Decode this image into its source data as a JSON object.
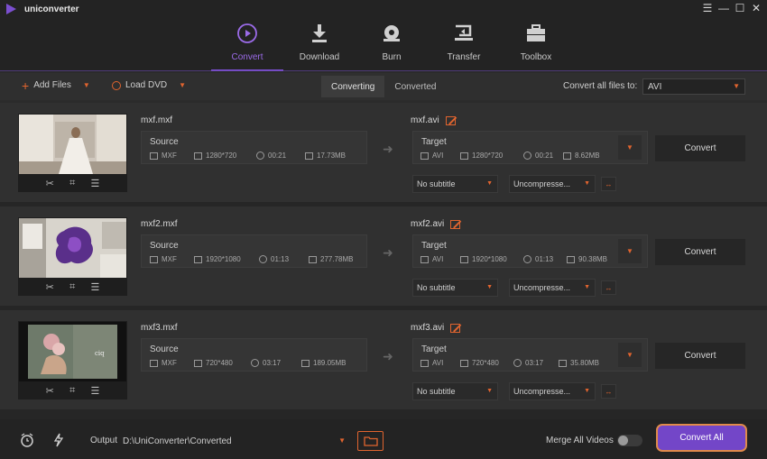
{
  "app": {
    "title": "uniconverter"
  },
  "window_controls": [
    "menu-icon",
    "minimize-icon",
    "maximize-icon",
    "close-icon"
  ],
  "nav": [
    {
      "label": "Convert",
      "icon": "convert-icon",
      "active": true
    },
    {
      "label": "Download",
      "icon": "download-icon",
      "active": false
    },
    {
      "label": "Burn",
      "icon": "burn-icon",
      "active": false
    },
    {
      "label": "Transfer",
      "icon": "transfer-icon",
      "active": false
    },
    {
      "label": "Toolbox",
      "icon": "toolbox-icon",
      "active": false
    }
  ],
  "toolbar": {
    "add_files": "Add Files",
    "load_dvd": "Load DVD",
    "tabs": [
      "Converting",
      "Converted"
    ],
    "active_tab": "Converting",
    "convert_all_label": "Convert all files to:",
    "convert_all_format": "AVI"
  },
  "files": [
    {
      "source_name": "mxf.mxf",
      "source": {
        "title": "Source",
        "format": "MXF",
        "resolution": "1280*720",
        "duration": "00:21",
        "size": "17.73MB"
      },
      "target_name": "mxf.avi",
      "target": {
        "title": "Target",
        "format": "AVI",
        "resolution": "1280*720",
        "duration": "00:21",
        "size": "8.62MB"
      },
      "subtitle": "No subtitle",
      "audio": "Uncompresse...",
      "convert_label": "Convert"
    },
    {
      "source_name": "mxf2.mxf",
      "source": {
        "title": "Source",
        "format": "MXF",
        "resolution": "1920*1080",
        "duration": "01:13",
        "size": "277.78MB"
      },
      "target_name": "mxf2.avi",
      "target": {
        "title": "Target",
        "format": "AVI",
        "resolution": "1920*1080",
        "duration": "01:13",
        "size": "90.38MB"
      },
      "subtitle": "No subtitle",
      "audio": "Uncompresse...",
      "convert_label": "Convert"
    },
    {
      "source_name": "mxf3.mxf",
      "source": {
        "title": "Source",
        "format": "MXF",
        "resolution": "720*480",
        "duration": "03:17",
        "size": "189.05MB"
      },
      "target_name": "mxf3.avi",
      "target": {
        "title": "Target",
        "format": "AVI",
        "resolution": "720*480",
        "duration": "03:17",
        "size": "35.80MB"
      },
      "subtitle": "No subtitle",
      "audio": "Uncompresse...",
      "convert_label": "Convert"
    }
  ],
  "footer": {
    "output_label": "Output",
    "output_path": "D:\\UniConverter\\Converted",
    "merge_label": "Merge All Videos",
    "merge_enabled": false,
    "convert_all_button": "Convert All"
  },
  "colors": {
    "accent": "#7b4fd0",
    "orange": "#e0642f",
    "bg": "#2b2b2b"
  }
}
